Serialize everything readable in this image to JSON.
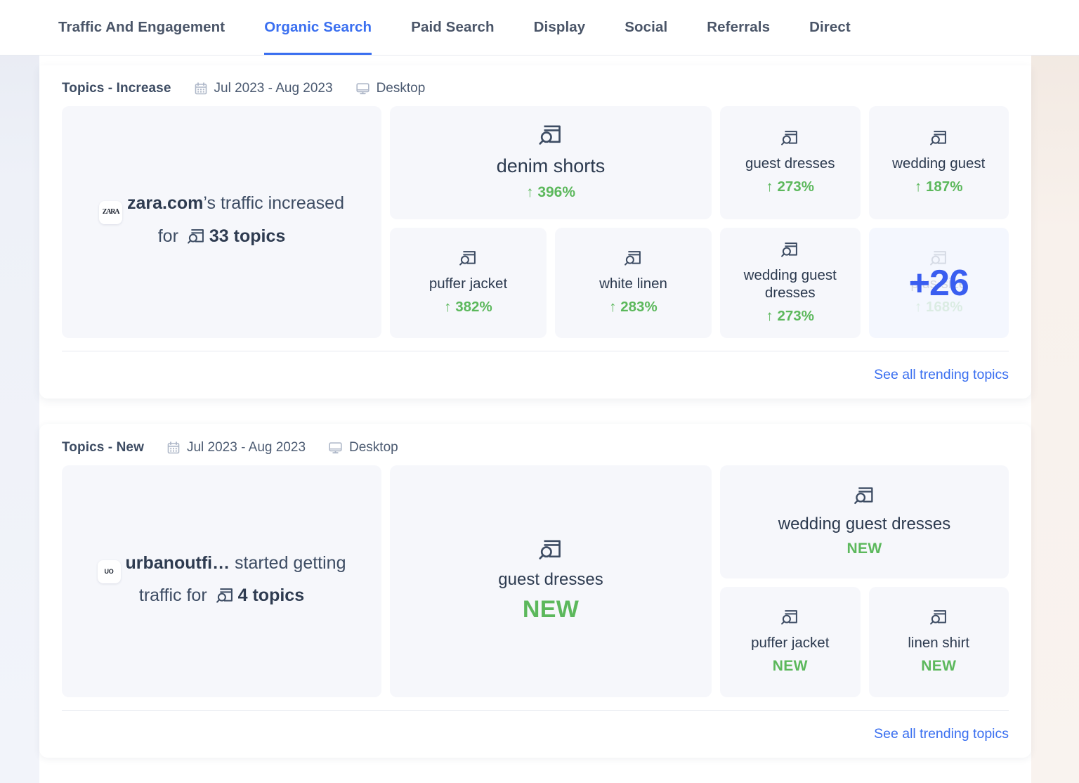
{
  "tabs": [
    {
      "label": "Traffic And Engagement",
      "active": false
    },
    {
      "label": "Organic Search",
      "active": true
    },
    {
      "label": "Paid Search",
      "active": false
    },
    {
      "label": "Display",
      "active": false
    },
    {
      "label": "Social",
      "active": false
    },
    {
      "label": "Referrals",
      "active": false
    },
    {
      "label": "Direct",
      "active": false
    }
  ],
  "colors": {
    "accent_blue": "#3a6ff0",
    "count_blue": "#3a5ef0",
    "positive_green": "#5cb85c",
    "text_dark": "#2c3a4f",
    "tile_bg": "#f6f7fb"
  },
  "cards": [
    {
      "title": "Topics - Increase",
      "date_range": "Jul 2023 - Aug 2023",
      "device": "Desktop",
      "calendar_icon": "calendar-icon",
      "device_icon": "desktop-icon",
      "summary": {
        "favicon_text": "ZARA",
        "domain": "zara.com",
        "text_before": "’s traffic",
        "text_middle": "increased for",
        "topic_icon": "topic-search-icon",
        "count_label": "33 topics"
      },
      "hero": {
        "icon": "topic-search-icon",
        "name": "denim shorts",
        "arrow": "↑",
        "delta": "396%"
      },
      "tiles_row1_right": [
        {
          "icon": "topic-search-icon",
          "name": "guest dresses",
          "arrow": "↑",
          "delta": "273%"
        },
        {
          "icon": "topic-search-icon",
          "name": "wedding guest",
          "arrow": "↑",
          "delta": "187%"
        }
      ],
      "tiles_row2_mid": [
        {
          "icon": "topic-search-icon",
          "name": "puffer jacket",
          "arrow": "↑",
          "delta": "382%"
        },
        {
          "icon": "topic-search-icon",
          "name": "white linen",
          "arrow": "↑",
          "delta": "283%"
        }
      ],
      "tiles_row2_right": [
        {
          "icon": "topic-search-icon",
          "name": "wedding guest dresses",
          "arrow": "↑",
          "delta": "273%"
        }
      ],
      "more_tile": {
        "count": "+26",
        "ghost_icon": "topic-search-icon",
        "ghost_name": "plus size",
        "ghost_arrow": "↑",
        "ghost_delta": "168%"
      },
      "footer_link": "See all trending topics"
    },
    {
      "title": "Topics - New",
      "date_range": "Jul 2023 - Aug 2023",
      "device": "Desktop",
      "calendar_icon": "calendar-icon",
      "device_icon": "desktop-icon",
      "summary": {
        "favicon_text": "UO",
        "domain": "urbanoutfi…",
        "text_before": "  started",
        "text_middle": "getting traffic for",
        "topic_icon": "topic-search-icon",
        "count_label": "4 topics"
      },
      "hero": {
        "icon": "topic-search-icon",
        "name": "guest dresses",
        "badge": "NEW"
      },
      "wide_tile": {
        "icon": "topic-search-icon",
        "name": "wedding guest dresses",
        "badge": "NEW"
      },
      "tiles_row2_right": [
        {
          "icon": "topic-search-icon",
          "name": "puffer jacket",
          "badge": "NEW"
        },
        {
          "icon": "topic-search-icon",
          "name": "linen shirt",
          "badge": "NEW"
        }
      ],
      "footer_link": "See all trending topics"
    }
  ]
}
